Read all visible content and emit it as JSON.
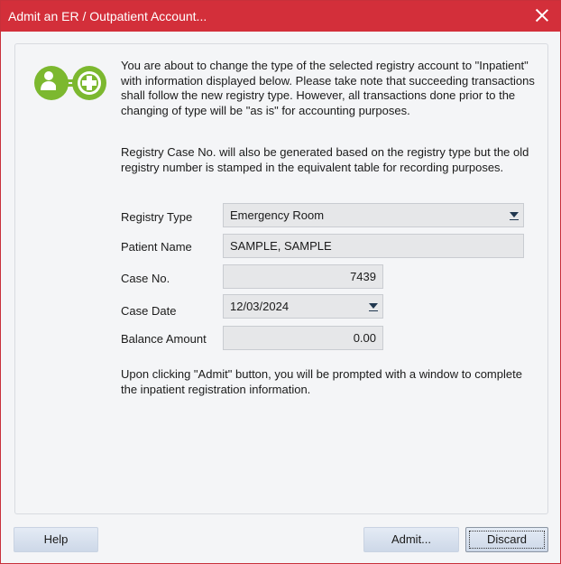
{
  "window": {
    "title": "Admit an ER / Outpatient Account..."
  },
  "intro": {
    "paragraph1": "You are about to change the type of the selected registry account to \"Inpatient\" with information displayed below. Please take note that succeeding transactions shall follow the new registry type. However, all transactions done prior to the changing of type will be \"as is\" for accounting purposes.",
    "paragraph2": "Registry Case No. will also be generated based on the registry type but the old registry number is stamped in the equivalent table for recording purposes.",
    "paragraph3": "Upon clicking \"Admit\" button, you will be prompted with a window to complete the inpatient registration information."
  },
  "form": {
    "registry_type": {
      "label": "Registry Type",
      "value": "Emergency Room"
    },
    "patient_name": {
      "label": "Patient Name",
      "value": "SAMPLE, SAMPLE"
    },
    "case_no": {
      "label": "Case No.",
      "value": "7439"
    },
    "case_date": {
      "label": "Case Date",
      "value": "12/03/2024"
    },
    "balance_amount": {
      "label": "Balance Amount",
      "value": "0.00"
    }
  },
  "buttons": {
    "help": "Help",
    "admit": "Admit...",
    "discard": "Discard"
  },
  "colors": {
    "titlebar": "#d32f3a",
    "logo_green": "#7cb82f"
  },
  "icons": {
    "logo": "patient-transfer-icon",
    "close": "close-icon",
    "dropdown": "chevron-down-icon"
  }
}
